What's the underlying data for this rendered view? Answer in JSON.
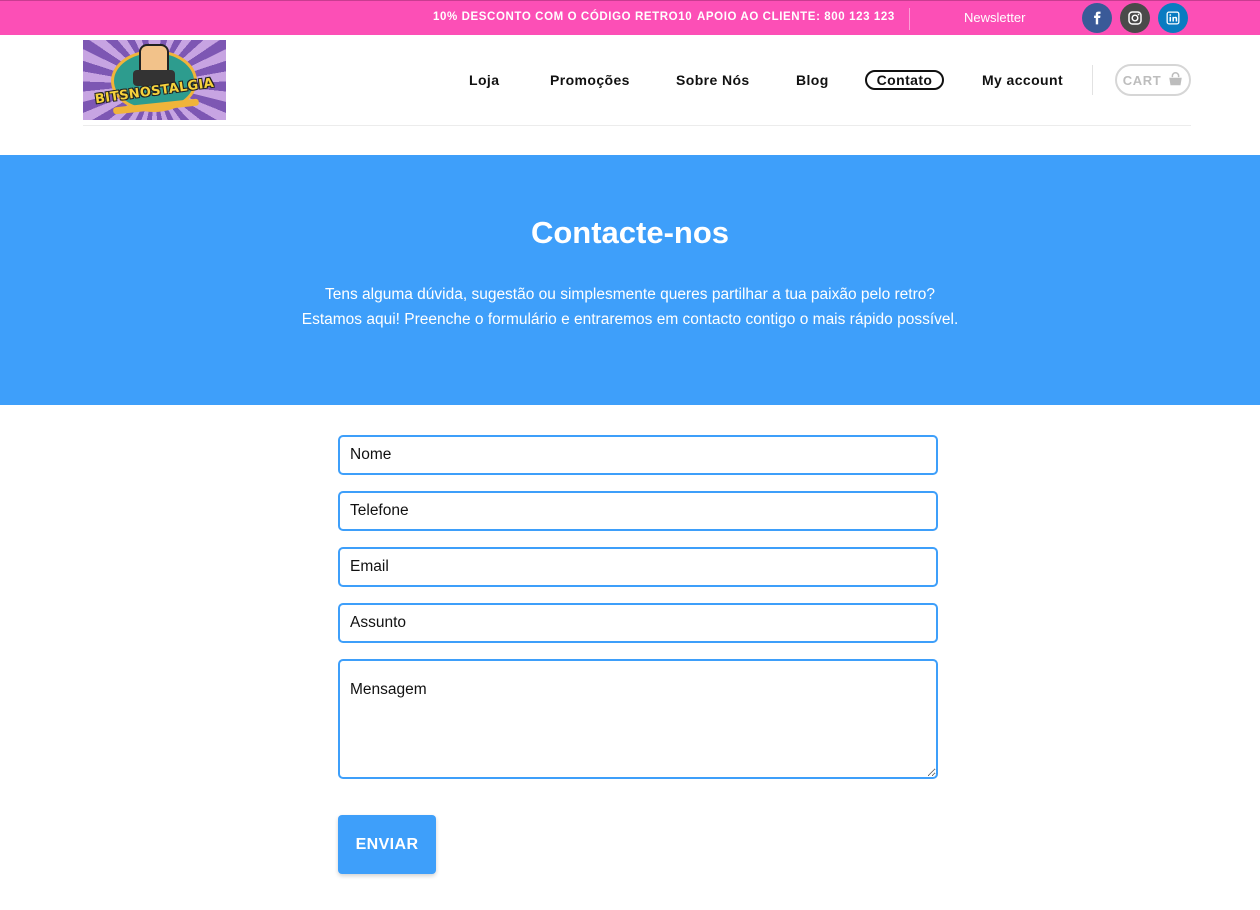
{
  "topbar": {
    "promo_code": "10% DESCONTO COM O CÓDIGO RETRO10",
    "support": "APOIO AO CLIENTE: 800 123 123",
    "newsletter": "Newsletter",
    "social_icons": [
      "facebook-icon",
      "instagram-icon",
      "linkedin-icon"
    ]
  },
  "logo": {
    "text": "BITSNOSTALGIA"
  },
  "nav": {
    "items": [
      "Loja",
      "Promoções",
      "Sobre Nós",
      "Blog",
      "Contato",
      "My account"
    ],
    "active": "Contato"
  },
  "cart": {
    "label": "CART",
    "icon": "bag-icon"
  },
  "hero": {
    "title": "Contacte-nos",
    "line1": "Tens alguma dúvida, sugestão ou simplesmente queres partilhar a tua paixão pelo retro?",
    "line2": "Estamos aqui! Preenche o formulário e entraremos em contacto contigo o mais rápido possível."
  },
  "form": {
    "name_placeholder": "Nome",
    "phone_placeholder": "Telefone",
    "email_placeholder": "Email",
    "subject_placeholder": "Assunto",
    "message_placeholder": "Mensagem",
    "submit_label": "ENVIAR"
  },
  "colors": {
    "topbar": "#fc4fb6",
    "accent": "#3e9ffa",
    "facebook": "#3a5a98",
    "instagram": "#4a4a4a",
    "linkedin": "#0a7bc1"
  }
}
